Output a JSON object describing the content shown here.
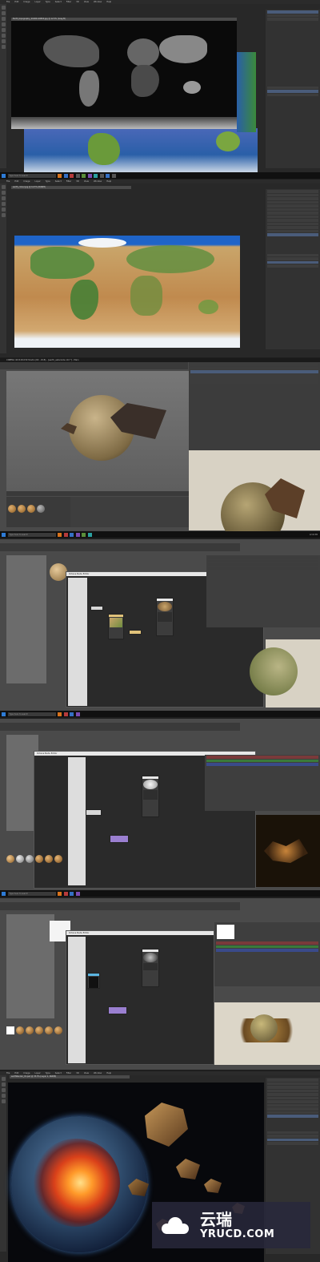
{
  "frames": [
    {
      "app": "photoshop",
      "menu": [
        "File",
        "Edit",
        "Image",
        "Layer",
        "Type",
        "Select",
        "Filter",
        "3D",
        "View",
        "Window",
        "Help"
      ],
      "doc_tab": "Earth_topography_21600x10800.jpg @ 12.5% (Gray/8)",
      "doc_status": "12.5%"
    },
    {
      "app": "photoshop",
      "menu": [
        "File",
        "Edit",
        "Image",
        "Layer",
        "Type",
        "Select",
        "Filter",
        "3D",
        "View",
        "Window",
        "Help"
      ],
      "doc_tab": "earth_colour.jpg @ 12.5% (RGB/8)"
    },
    {
      "app": "cinema4d",
      "title": "CINEMA 4D R18.039 Studio (RC - R18) - [earth_asteroids.c4d *] - Main"
    },
    {
      "app": "cinema4d",
      "node_editor_title": "Octane Node Editor"
    },
    {
      "app": "cinema4d",
      "node_editor_title": "Octane Node Editor"
    },
    {
      "app": "cinema4d",
      "node_editor_title": "Octane Node Editor"
    },
    {
      "app": "photoshop",
      "menu": [
        "File",
        "Edit",
        "Image",
        "Layer",
        "Type",
        "Select",
        "Filter",
        "3D",
        "View",
        "Window",
        "Help"
      ],
      "doc_tab": "earthRender_01.psd @ 33.3% (Layer 1, RGB/8)"
    }
  ],
  "taskbar": {
    "search_placeholder": "Type here to search",
    "clock": "12:00 PM"
  },
  "watermark": {
    "brand_cn": "云瑞",
    "brand_en": "YRUCD.COM"
  },
  "colors": {
    "accent": "#d8731c",
    "ps_bg": "#282828",
    "c4d_bg": "#4a4a4a",
    "ocean": "#2a5fa8"
  }
}
